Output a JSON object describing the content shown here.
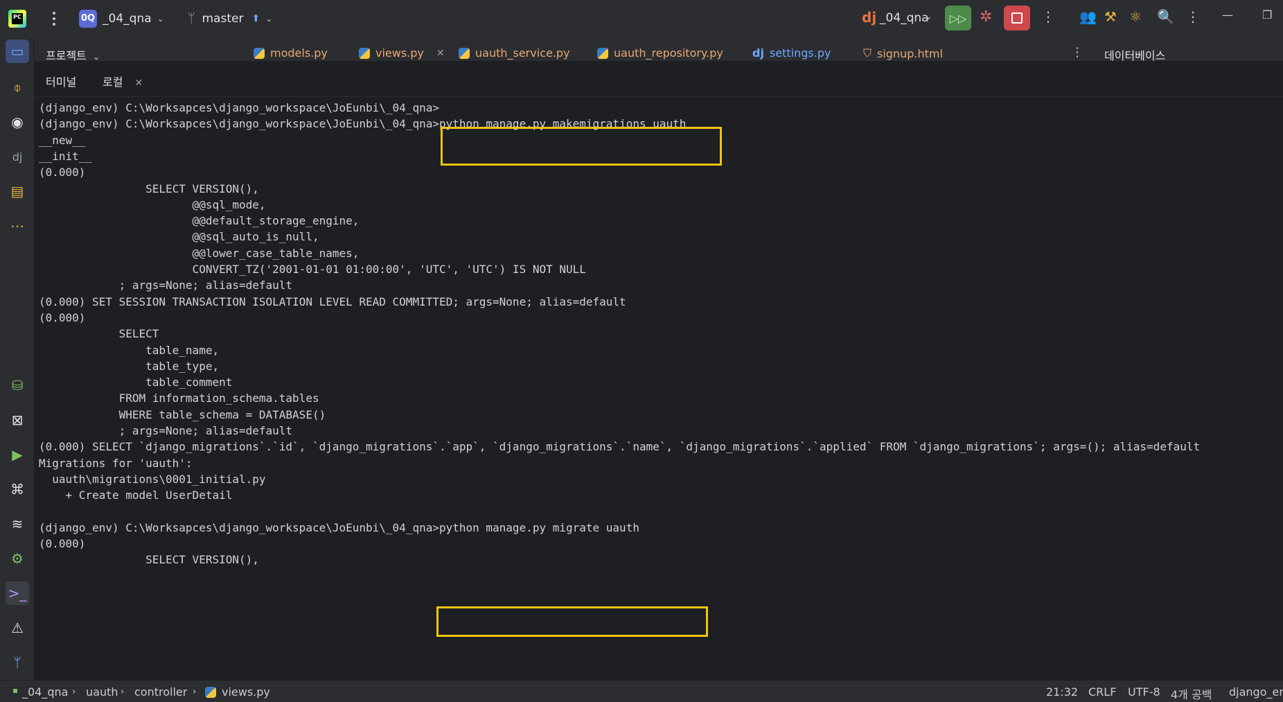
{
  "titlebar": {
    "app_logo_text": "PC",
    "project_badge": "0Q",
    "project_name": "_04_qna",
    "branch_name": "master",
    "run_config_name": "_04_qna"
  },
  "tool_window": {
    "project_label": "프로젝트",
    "database_label": "데이터베이스"
  },
  "editor_tabs": [
    {
      "label": "models.py",
      "color": "#e8a870"
    },
    {
      "label": "views.py",
      "color": "#e8a870"
    },
    {
      "label": "uauth_service.py",
      "color": "#e8a870"
    },
    {
      "label": "uauth_repository.py",
      "color": "#e8a870"
    },
    {
      "label": "settings.py",
      "color": "#6ea8fe"
    },
    {
      "label": "signup.html",
      "color": "#e8a870"
    }
  ],
  "terminal_tabs": {
    "terminal_label": "터미널",
    "local_label": "로컬"
  },
  "terminal_lines": [
    "(django_env) C:\\Worksapces\\django_workspace\\JoEunbi\\_04_qna>",
    "(django_env) C:\\Worksapces\\django_workspace\\JoEunbi\\_04_qna>python manage.py makemigrations uauth",
    "__new__",
    "__init__",
    "(0.000)",
    "                SELECT VERSION(),",
    "                       @@sql_mode,",
    "                       @@default_storage_engine,",
    "                       @@sql_auto_is_null,",
    "                       @@lower_case_table_names,",
    "                       CONVERT_TZ('2001-01-01 01:00:00', 'UTC', 'UTC') IS NOT NULL",
    "            ; args=None; alias=default",
    "(0.000) SET SESSION TRANSACTION ISOLATION LEVEL READ COMMITTED; args=None; alias=default",
    "(0.000)",
    "            SELECT",
    "                table_name,",
    "                table_type,",
    "                table_comment",
    "            FROM information_schema.tables",
    "            WHERE table_schema = DATABASE()",
    "            ; args=None; alias=default",
    "(0.000) SELECT `django_migrations`.`id`, `django_migrations`.`app`, `django_migrations`.`name`, `django_migrations`.`applied` FROM `django_migrations`; args=(); alias=default",
    "Migrations for 'uauth':",
    "  uauth\\migrations\\0001_initial.py",
    "    + Create model UserDetail",
    "",
    "(django_env) C:\\Worksapces\\django_workspace\\JoEunbi\\_04_qna>python manage.py migrate uauth",
    "(0.000)",
    "                SELECT VERSION(),"
  ],
  "statusbar": {
    "crumb_project": "_04_qna",
    "crumb_app": "uauth",
    "crumb_folder": "controller",
    "crumb_file": "views.py",
    "cursor_pos": "21:32",
    "line_sep": "CRLF",
    "encoding": "UTF-8",
    "indent": "4개 공백",
    "interpreter": "django_env"
  },
  "colors": {
    "highlight_box": "#f2c40f",
    "run_button": "#4c8b4a",
    "stop_button": "#d0484c",
    "active_tab_underline": "#4d84f5"
  }
}
